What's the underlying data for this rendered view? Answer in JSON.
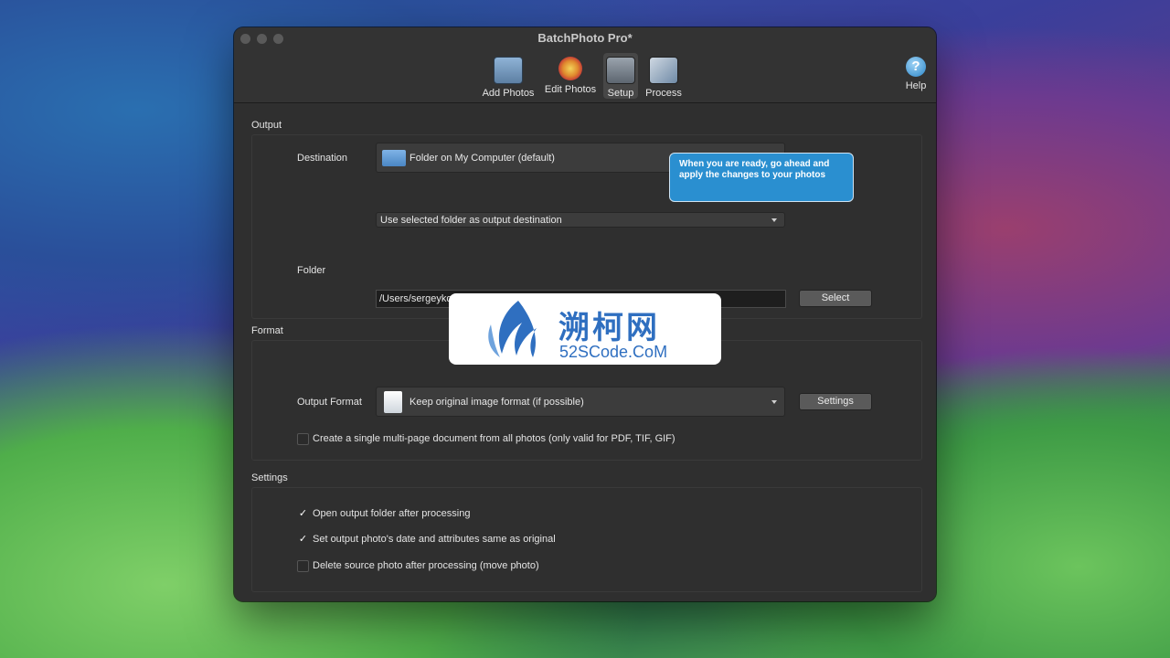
{
  "window": {
    "title": "BatchPhoto Pro*"
  },
  "toolbar": {
    "items": [
      {
        "label": "Add Photos"
      },
      {
        "label": "Edit Photos"
      },
      {
        "label": "Setup"
      },
      {
        "label": "Process"
      }
    ],
    "help_label": "Help"
  },
  "tooltip": {
    "text": "When you are ready, go ahead and apply the changes to your photos"
  },
  "output": {
    "section_label": "Output",
    "destination_label": "Destination",
    "destination_value": "Folder on My Computer (default)",
    "destination_mode": "Use selected folder as output destination",
    "folder_label": "Folder",
    "folder_value": "/Users/sergeykochkin/Pictures",
    "select_button": "Select"
  },
  "format": {
    "section_label": "Format",
    "output_format_label": "Output Format",
    "output_format_value": "Keep original image format (if possible)",
    "settings_button": "Settings",
    "multipage_label": "Create a single multi-page document from all photos (only valid for PDF, TIF, GIF)",
    "multipage_checked": false
  },
  "settings": {
    "section_label": "Settings",
    "options": [
      {
        "label": "Open output folder after processing",
        "checked": true
      },
      {
        "label": "Set output photo's date and attributes same as original",
        "checked": true
      },
      {
        "label": "Delete source photo after processing (move photo)",
        "checked": false
      }
    ]
  },
  "watermark": {
    "cn": "溯柯网",
    "en": "52SCode.CoM"
  },
  "colors": {
    "accent": "#2a8fd0",
    "window_bg": "#2f2f2f",
    "watermark_blue": "#2f6fc0"
  }
}
